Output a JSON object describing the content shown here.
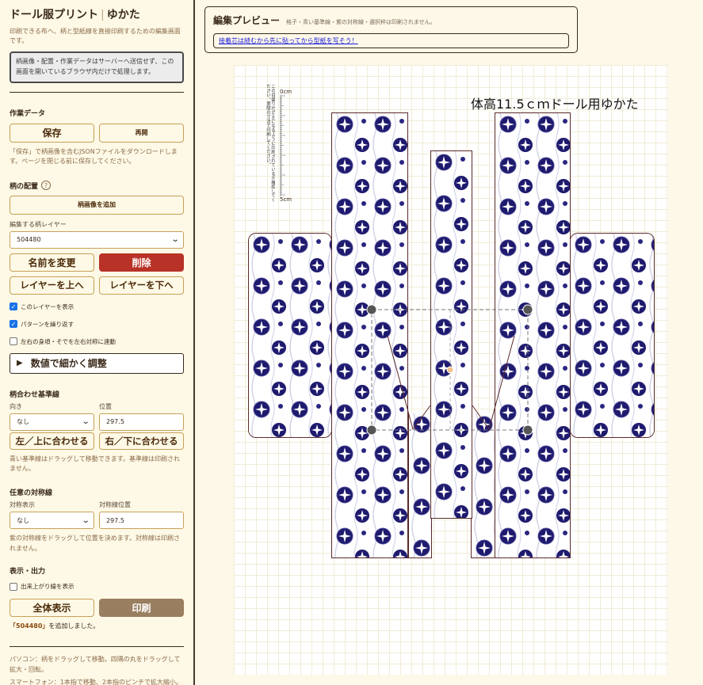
{
  "app": {
    "title_main": "ドール服プリント",
    "title_sep": "|",
    "title_sub": "ゆかた",
    "description": "印刷できる布へ、柄と型紙線を直接印刷するための編集画面です。",
    "privacy": "柄画像・配置・作業データはサーバーへ送信せず、この画面を開いているブラウザ内だけで処理します。"
  },
  "work_data": {
    "title": "作業データ",
    "save": "保存",
    "resume": "再開",
    "note": "「保存」で柄画像を含むJSONファイルをダウンロードします。ページを閉じる前に保存してください。"
  },
  "pattern": {
    "title": "柄の配置",
    "help_glyph": "?",
    "add_image": "柄画像を追加",
    "layer_label": "編集する柄レイヤー",
    "layer_value": "504480",
    "rename": "名前を変更",
    "delete": "削除",
    "layer_up": "レイヤーを上へ",
    "layer_down": "レイヤーを下へ",
    "show_layer": "このレイヤーを表示",
    "repeat": "パターンを繰り返す",
    "mirror": "左右の身頃・そでを左右対称に連動",
    "fine_tune": "数値で細かく調整"
  },
  "align": {
    "title": "柄合わせ基準線",
    "direction_label": "向き",
    "direction_value": "なし",
    "position_label": "位置",
    "position_value": "297.5",
    "align_left": "左／上に合わせる",
    "align_right": "右／下に合わせる",
    "note": "青い基準線はドラッグして移動できます。基準線は印刷されません。"
  },
  "symmetry": {
    "title": "任意の対称線",
    "display_label": "対称表示",
    "display_value": "なし",
    "position_label": "対称線位置",
    "position_value": "297.5",
    "note": "紫の対称線をドラッグして位置を決めます。対称線は印刷されません。"
  },
  "output": {
    "title": "表示・出力",
    "finished_view": "出来上がり線を表示",
    "fit_all": "全体表示",
    "print": "印刷",
    "status_prefix": "「504480」",
    "status_suffix": "を追加しました。",
    "tips_pc": "パソコン：柄をドラッグして移動。四隅の丸をドラッグして拡大・回転。",
    "tips_phone": "スマートフォン：1本指で移動、2本指のピンチで拡大縮小。"
  },
  "preview": {
    "title": "編集プレビュー",
    "subtitle": "格子・青い基準線・紫の対称線・選択枠は印刷されません。",
    "tip_link": "接着芯は縫むから先に貼ってから型紙を写そう！",
    "doll_title": "体高11.5ｃｍドール用ゆかた",
    "scale_label_top": "0cm",
    "scale_label_bottom": "5cm",
    "scale_note": "この目盛りが5cmになるように印刷されているか確認してください。実際の寸法で印刷してください。"
  },
  "colors": {
    "accent": "#c8a05a",
    "delete": "#b83228",
    "print": "#9a7e60",
    "motif": "#1e1a6e",
    "checkbox": "#1a73e8"
  },
  "icons": {
    "checkbox_on": "check-icon",
    "select": "chevron-down-icon",
    "fold": "triangle-right-icon",
    "help": "question-icon"
  }
}
